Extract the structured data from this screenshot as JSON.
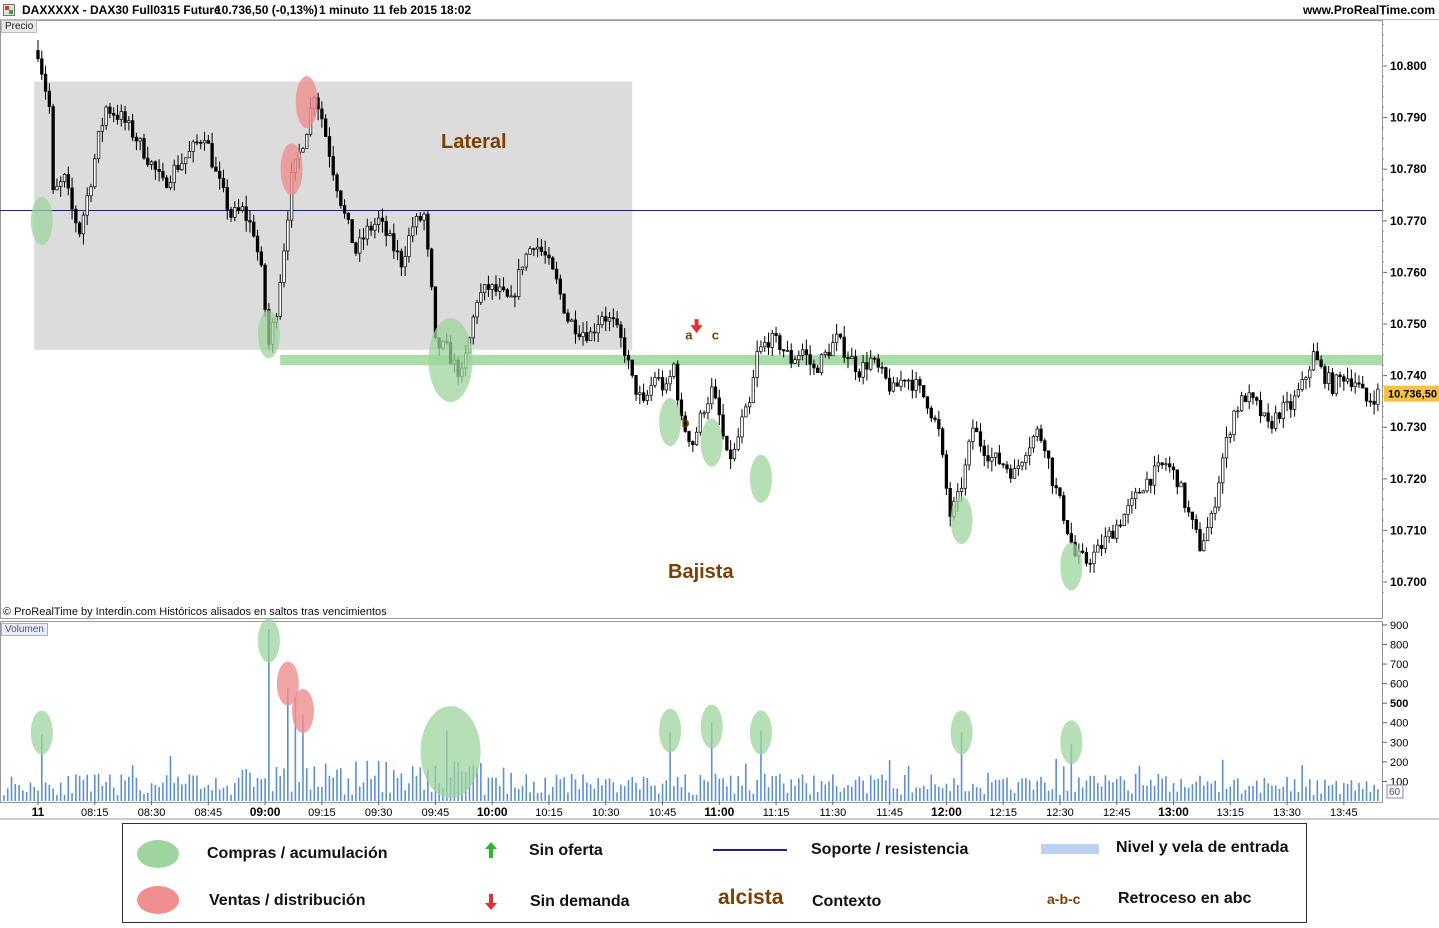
{
  "header": {
    "symbol": "DAXXXXX - DAX30 Full0315 Future",
    "last": "10.736,50 (-0,13%)",
    "timeframe": "1 minuto",
    "datetime": "11 feb 2015 18:02",
    "site": "www.ProRealTime.com"
  },
  "panels": {
    "price_label": "Precio",
    "volume_label": "Volumen",
    "copyright": "© ProRealTime by Interdin.com  Históricos alisados en saltos tras vencimientos"
  },
  "colors": {
    "buy": "#9ed49e",
    "sell": "#ef8f8f",
    "support_line": "#1c1ca8",
    "entry_band": "#a8dca8",
    "lateral_box": "#dcdcdc",
    "context_text": "#7b3f00",
    "volume_bar": "#5b8fd6",
    "last_price_bg": "#f5c242"
  },
  "annotations": {
    "lateral": "Lateral",
    "bajista": "Bajista",
    "a": "a",
    "b": "b",
    "c": "c"
  },
  "legend": {
    "buy": "Compras / acumulación",
    "sell": "Ventas / distribución",
    "no_supply": "Sin oferta",
    "no_demand": "Sin demanda",
    "support": "Soporte / resistencia",
    "context_word": "alcista",
    "context": "Contexto",
    "entry": "Nivel y vela de entrada",
    "abc_word": "a-b-c",
    "abc": "Retroceso en abc",
    "icons": [
      "green-ellipse",
      "red-ellipse",
      "green-up-arrow",
      "red-down-arrow",
      "blue-line",
      "light-blue-bar"
    ]
  },
  "chart_data": [
    {
      "type": "candlestick",
      "name": "Precio",
      "x_time_range": [
        "08:00",
        "13:55"
      ],
      "x_ticks": [
        {
          "t": 0,
          "label": "11",
          "bold": true
        },
        {
          "t": 15,
          "label": "08:15"
        },
        {
          "t": 30,
          "label": "08:30"
        },
        {
          "t": 45,
          "label": "08:45"
        },
        {
          "t": 60,
          "label": "09:00",
          "bold": true
        },
        {
          "t": 75,
          "label": "09:15"
        },
        {
          "t": 90,
          "label": "09:30"
        },
        {
          "t": 105,
          "label": "09:45"
        },
        {
          "t": 120,
          "label": "10:00",
          "bold": true
        },
        {
          "t": 135,
          "label": "10:15"
        },
        {
          "t": 150,
          "label": "10:30"
        },
        {
          "t": 165,
          "label": "10:45"
        },
        {
          "t": 180,
          "label": "11:00",
          "bold": true
        },
        {
          "t": 195,
          "label": "11:15"
        },
        {
          "t": 210,
          "label": "11:30"
        },
        {
          "t": 225,
          "label": "11:45"
        },
        {
          "t": 240,
          "label": "12:00",
          "bold": true
        },
        {
          "t": 255,
          "label": "12:15"
        },
        {
          "t": 270,
          "label": "12:30"
        },
        {
          "t": 285,
          "label": "12:45"
        },
        {
          "t": 300,
          "label": "13:00",
          "bold": true
        },
        {
          "t": 315,
          "label": "13:15"
        },
        {
          "t": 330,
          "label": "13:30"
        },
        {
          "t": 345,
          "label": "13:45"
        }
      ],
      "y_range": [
        10697,
        10810
      ],
      "y_ticks": [
        10700,
        10710,
        10720,
        10730,
        10740,
        10750,
        10760,
        10770,
        10780,
        10790,
        10800
      ],
      "y_tick_labels": [
        "10.700",
        "10.710",
        "10.720",
        "10.730",
        "10.740",
        "10.750",
        "10.760",
        "10.770",
        "10.780",
        "10.790",
        "10.800"
      ],
      "last_price": 10736.5,
      "last_price_label": "10.736,50",
      "support_line": 10772,
      "entry_band": [
        10742,
        10744
      ],
      "lateral_box": {
        "t_start": -1,
        "t_end": 157,
        "y_low": 10745,
        "y_high": 10797
      },
      "path_points": [
        [
          0,
          10803
        ],
        [
          3,
          10792
        ],
        [
          4,
          10775
        ],
        [
          7,
          10778
        ],
        [
          9,
          10772
        ],
        [
          11,
          10768
        ],
        [
          14,
          10778
        ],
        [
          16,
          10786
        ],
        [
          18,
          10792
        ],
        [
          22,
          10790
        ],
        [
          26,
          10786
        ],
        [
          30,
          10781
        ],
        [
          33,
          10777
        ],
        [
          36,
          10780
        ],
        [
          40,
          10783
        ],
        [
          44,
          10787
        ],
        [
          47,
          10779
        ],
        [
          51,
          10771
        ],
        [
          54,
          10772
        ],
        [
          57,
          10768
        ],
        [
          59,
          10760
        ],
        [
          61,
          10746
        ],
        [
          63,
          10753
        ],
        [
          65,
          10765
        ],
        [
          67,
          10778
        ],
        [
          69,
          10783
        ],
        [
          71,
          10788
        ],
        [
          73,
          10795
        ],
        [
          75,
          10790
        ],
        [
          78,
          10780
        ],
        [
          81,
          10771
        ],
        [
          84,
          10764
        ],
        [
          87,
          10768
        ],
        [
          90,
          10770
        ],
        [
          93,
          10766
        ],
        [
          96,
          10762
        ],
        [
          99,
          10769
        ],
        [
          102,
          10771
        ],
        [
          104,
          10756
        ],
        [
          105,
          10746
        ],
        [
          108,
          10745
        ],
        [
          110,
          10742
        ],
        [
          112,
          10740
        ],
        [
          114,
          10747
        ],
        [
          116,
          10755
        ],
        [
          119,
          10757
        ],
        [
          122,
          10756
        ],
        [
          125,
          10754
        ],
        [
          128,
          10762
        ],
        [
          131,
          10766
        ],
        [
          134,
          10763
        ],
        [
          137,
          10758
        ],
        [
          140,
          10751
        ],
        [
          143,
          10749
        ],
        [
          146,
          10748
        ],
        [
          149,
          10752
        ],
        [
          152,
          10750
        ],
        [
          155,
          10745
        ],
        [
          157,
          10739
        ],
        [
          160,
          10734
        ],
        [
          163,
          10740
        ],
        [
          166,
          10737
        ],
        [
          168,
          10742
        ],
        [
          170,
          10731
        ],
        [
          173,
          10727
        ],
        [
          176,
          10734
        ],
        [
          178,
          10737
        ],
        [
          180,
          10732
        ],
        [
          182,
          10724
        ],
        [
          184,
          10725
        ],
        [
          186,
          10731
        ],
        [
          188,
          10734
        ],
        [
          190,
          10744
        ],
        [
          193,
          10747
        ],
        [
          196,
          10746
        ],
        [
          199,
          10743
        ],
        [
          202,
          10745
        ],
        [
          205,
          10741
        ],
        [
          208,
          10744
        ],
        [
          211,
          10747
        ],
        [
          214,
          10744
        ],
        [
          217,
          10741
        ],
        [
          220,
          10743
        ],
        [
          223,
          10740
        ],
        [
          226,
          10737
        ],
        [
          229,
          10740
        ],
        [
          232,
          10738
        ],
        [
          235,
          10735
        ],
        [
          238,
          10729
        ],
        [
          240,
          10718
        ],
        [
          241,
          10713
        ],
        [
          243,
          10716
        ],
        [
          245,
          10722
        ],
        [
          247,
          10730
        ],
        [
          249,
          10727
        ],
        [
          252,
          10724
        ],
        [
          255,
          10723
        ],
        [
          258,
          10721
        ],
        [
          261,
          10726
        ],
        [
          264,
          10729
        ],
        [
          266,
          10727
        ],
        [
          268,
          10720
        ],
        [
          271,
          10713
        ],
        [
          274,
          10705
        ],
        [
          277,
          10704
        ],
        [
          280,
          10706
        ],
        [
          283,
          10709
        ],
        [
          286,
          10712
        ],
        [
          289,
          10715
        ],
        [
          292,
          10719
        ],
        [
          295,
          10721
        ],
        [
          298,
          10723
        ],
        [
          301,
          10720
        ],
        [
          304,
          10713
        ],
        [
          307,
          10707
        ],
        [
          310,
          10712
        ],
        [
          313,
          10724
        ],
        [
          316,
          10733
        ],
        [
          319,
          10736
        ],
        [
          322,
          10734
        ],
        [
          325,
          10730
        ],
        [
          328,
          10733
        ],
        [
          331,
          10734
        ],
        [
          334,
          10738
        ],
        [
          337,
          10744
        ],
        [
          339,
          10741
        ],
        [
          342,
          10738
        ],
        [
          345,
          10740
        ],
        [
          348,
          10739
        ],
        [
          351,
          10735
        ],
        [
          354,
          10736.5
        ]
      ],
      "buy_markers": [
        {
          "t": 1,
          "y": 10770
        },
        {
          "t": 61,
          "y": 10748
        },
        {
          "t": 109,
          "y": 10743
        },
        {
          "t": 167,
          "y": 10731
        },
        {
          "t": 178,
          "y": 10727
        },
        {
          "t": 191,
          "y": 10720
        },
        {
          "t": 244,
          "y": 10712
        },
        {
          "t": 273,
          "y": 10703
        }
      ],
      "sell_markers": [
        {
          "t": 67,
          "y": 10780
        },
        {
          "t": 71,
          "y": 10793
        }
      ],
      "no_demand_arrow": {
        "t": 174,
        "y": 10749
      },
      "abc_labels": [
        {
          "label": "a",
          "t": 171,
          "y": 10747
        },
        {
          "label": "b",
          "t": 170,
          "y": 10730
        },
        {
          "label": "c",
          "t": 178,
          "y": 10747
        }
      ]
    },
    {
      "type": "bar",
      "name": "Volumen",
      "y_range": [
        0,
        920
      ],
      "y_ticks": [
        100,
        200,
        300,
        400,
        500,
        600,
        700,
        800,
        900
      ],
      "y_tick_labels": [
        "100",
        "200",
        "300",
        "400",
        "500",
        "600",
        "700",
        "800",
        "900"
      ],
      "current_volume_label": "60",
      "spikes": [
        {
          "t": 1,
          "v": 340
        },
        {
          "t": 61,
          "v": 880
        },
        {
          "t": 66,
          "v": 580
        },
        {
          "t": 68,
          "v": 530
        },
        {
          "t": 70,
          "v": 440
        },
        {
          "t": 108,
          "v": 360
        },
        {
          "t": 167,
          "v": 350
        },
        {
          "t": 178,
          "v": 400
        },
        {
          "t": 191,
          "v": 360
        },
        {
          "t": 244,
          "v": 350
        },
        {
          "t": 273,
          "v": 290
        }
      ],
      "buy_markers": [
        {
          "t": 1,
          "v": 350
        },
        {
          "t": 61,
          "v": 820
        },
        {
          "t": 109,
          "v": 250
        },
        {
          "t": 167,
          "v": 360
        },
        {
          "t": 178,
          "v": 380
        },
        {
          "t": 191,
          "v": 350
        },
        {
          "t": 244,
          "v": 350
        },
        {
          "t": 273,
          "v": 300
        }
      ],
      "sell_markers": [
        {
          "t": 66,
          "v": 600
        },
        {
          "t": 70,
          "v": 460
        }
      ]
    }
  ]
}
